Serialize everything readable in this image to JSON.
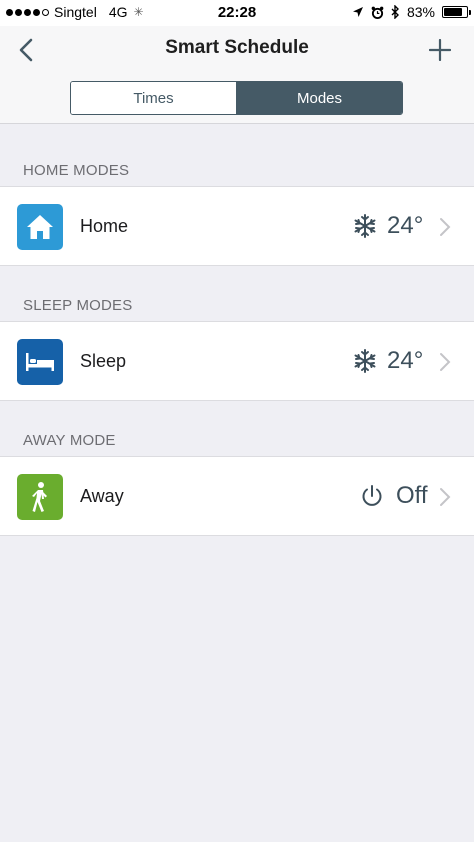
{
  "status_bar": {
    "carrier": "Singtel",
    "network": "4G",
    "time": "22:28",
    "battery": "83%",
    "battery_level": 0.83,
    "icons": [
      "signal-dots",
      "activity-spinner-icon",
      "location-arrow-icon",
      "alarm-clock-icon",
      "bluetooth-icon",
      "battery-icon"
    ]
  },
  "nav": {
    "title": "Smart Schedule",
    "back_icon": "chevron-left-icon",
    "add_icon": "plus-icon"
  },
  "segmented": {
    "tabs": [
      {
        "label": "Times",
        "active": false
      },
      {
        "label": "Modes",
        "active": true
      }
    ]
  },
  "sections": [
    {
      "header": "HOME MODES",
      "item": {
        "label": "Home",
        "icon": "house-icon",
        "icon_color": "#2d9ad6",
        "status_icon": "snowflake-icon",
        "value": "24°"
      }
    },
    {
      "header": "SLEEP MODES",
      "item": {
        "label": "Sleep",
        "icon": "bed-icon",
        "icon_color": "#1661a8",
        "status_icon": "snowflake-icon",
        "value": "24°"
      }
    },
    {
      "header": "AWAY MODE",
      "item": {
        "label": "Away",
        "icon": "walking-person-icon",
        "icon_color": "#6aad2e",
        "status_icon": "power-icon",
        "value": "Off"
      }
    }
  ],
  "colors": {
    "accent": "#455a66",
    "background": "#efeff4",
    "value_text": "#3d4f5b"
  }
}
